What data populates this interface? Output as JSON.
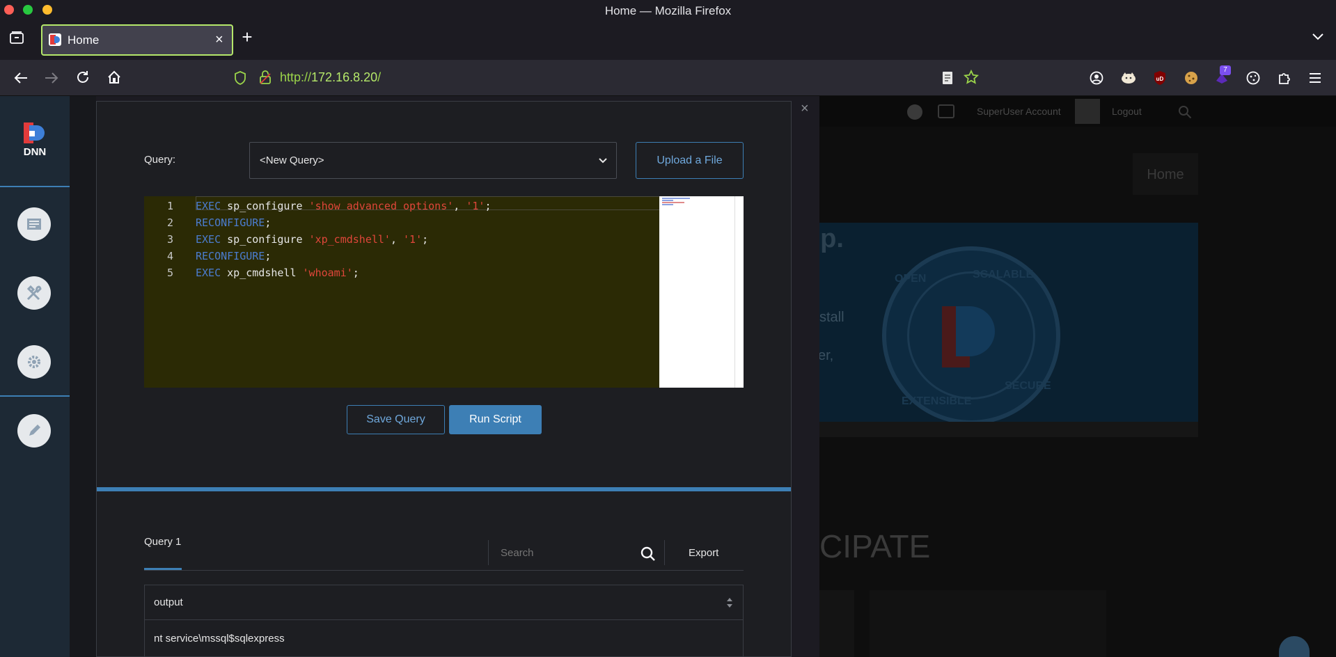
{
  "window": {
    "title": "Home — Mozilla Firefox"
  },
  "tab": {
    "title": "Home"
  },
  "url": {
    "scheme": "http://",
    "host": "172.16.8.20",
    "path": "/"
  },
  "toolbar": {
    "extension_badge": "7"
  },
  "site": {
    "header": {
      "user": "SuperUser Account",
      "logout": "Logout",
      "nav_home": "Home"
    },
    "hero_fragments": [
      "ep.",
      "stall",
      "ver,"
    ],
    "section_fragment": "CIPATE",
    "badge_words": [
      "OPEN",
      "SCALABLE",
      "EXTENSIBLE",
      "SECURE"
    ]
  },
  "dnn": {
    "logo_text": "DNN"
  },
  "sql": {
    "query_label": "Query:",
    "query_select": "<New Query>",
    "upload_label": "Upload a File",
    "lines": [
      [
        {
          "t": "EXEC",
          "c": "kw"
        },
        {
          "t": " sp_configure ",
          "c": "pl"
        },
        {
          "t": "'show advanced options'",
          "c": "str"
        },
        {
          "t": ", ",
          "c": "pl"
        },
        {
          "t": "'1'",
          "c": "str"
        },
        {
          "t": ";",
          "c": "pl"
        }
      ],
      [
        {
          "t": "RECONFIGURE",
          "c": "kw"
        },
        {
          "t": ";",
          "c": "pl"
        }
      ],
      [
        {
          "t": "EXEC",
          "c": "kw"
        },
        {
          "t": " sp_configure ",
          "c": "pl"
        },
        {
          "t": "'xp_cmdshell'",
          "c": "str"
        },
        {
          "t": ", ",
          "c": "pl"
        },
        {
          "t": "'1'",
          "c": "str"
        },
        {
          "t": ";",
          "c": "pl"
        }
      ],
      [
        {
          "t": "RECONFIGURE",
          "c": "kw"
        },
        {
          "t": ";",
          "c": "pl"
        }
      ],
      [
        {
          "t": "EXEC",
          "c": "kw"
        },
        {
          "t": " xp_cmdshell ",
          "c": "pl"
        },
        {
          "t": "'whoami'",
          "c": "str"
        },
        {
          "t": ";",
          "c": "pl"
        }
      ]
    ],
    "line_numbers": [
      "1",
      "2",
      "3",
      "4",
      "5"
    ],
    "save_label": "Save Query",
    "run_label": "Run Script",
    "results": {
      "tab_label": "Query 1",
      "search_placeholder": "Search",
      "export_label": "Export",
      "column": "output",
      "rows": [
        "nt service\\mssql$sqlexpress"
      ]
    }
  },
  "colors": {
    "accent": "#3d7fb5",
    "url_green": "#9bd44a",
    "editor_bg": "#2b2a05"
  }
}
